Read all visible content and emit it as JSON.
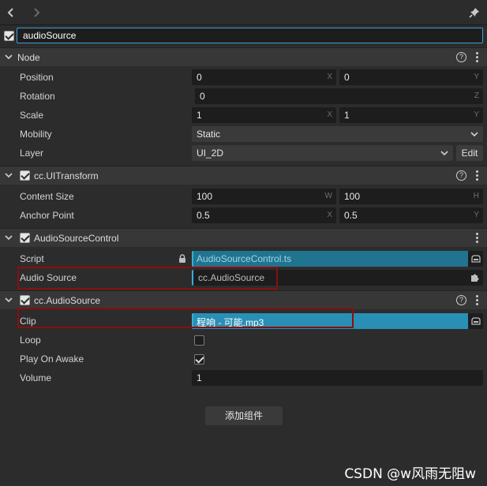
{
  "topbar": {
    "back_icon": "chevron-left",
    "forward_icon": "chevron-right",
    "pin_icon": "pin"
  },
  "node_name": {
    "value": "audioSource",
    "enabled": true
  },
  "sections": {
    "node": {
      "title": "Node",
      "position": {
        "label": "Position",
        "x": "0",
        "y": "0",
        "x_axis": "X",
        "y_axis": "Y"
      },
      "rotation": {
        "label": "Rotation",
        "z": "0",
        "z_axis": "Z"
      },
      "scale": {
        "label": "Scale",
        "x": "1",
        "y": "1",
        "x_axis": "X",
        "y_axis": "Y"
      },
      "mobility": {
        "label": "Mobility",
        "value": "Static"
      },
      "layer": {
        "label": "Layer",
        "value": "UI_2D",
        "edit_label": "Edit"
      }
    },
    "ui_transform": {
      "title": "cc.UITransform",
      "enabled": true,
      "content_size": {
        "label": "Content Size",
        "w": "100",
        "h": "100",
        "w_axis": "W",
        "h_axis": "H"
      },
      "anchor_point": {
        "label": "Anchor Point",
        "x": "0.5",
        "y": "0.5",
        "x_axis": "X",
        "y_axis": "Y"
      }
    },
    "audio_source_control": {
      "title": "AudioSourceControl",
      "enabled": true,
      "script": {
        "label": "Script",
        "value": "AudioSourceControl.ts"
      },
      "audio_source": {
        "label": "Audio Source",
        "value": "cc.AudioSource"
      }
    },
    "audio_source": {
      "title": "cc.AudioSource",
      "enabled": true,
      "clip": {
        "label": "Clip",
        "value": "程响 - 可能.mp3"
      },
      "loop": {
        "label": "Loop",
        "checked": false
      },
      "play_on_awake": {
        "label": "Play On Awake",
        "checked": true
      },
      "volume": {
        "label": "Volume",
        "value": "1"
      }
    }
  },
  "add_component_label": "添加组件",
  "watermark": "CSDN @w风雨无阻w",
  "colors": {
    "accent": "#3aa0d8",
    "asset_fill": "#21748f",
    "highlight": "#8b0e0e",
    "background": "#2c2c2c"
  }
}
